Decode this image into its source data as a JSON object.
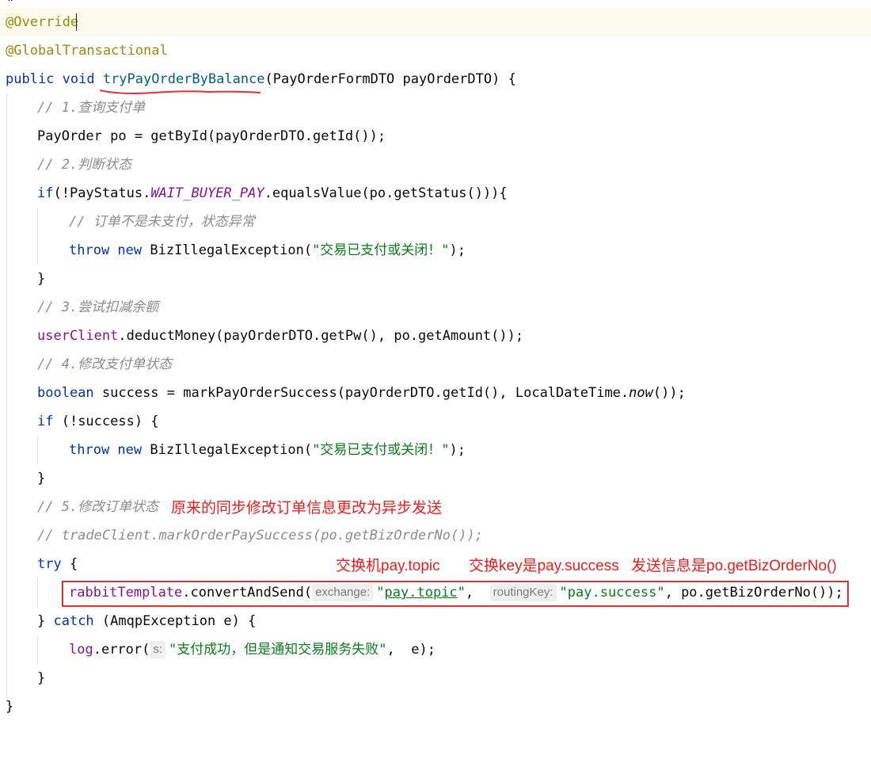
{
  "code_lines": {
    "l1": "@Override",
    "l2": "@GlobalTransactional",
    "l3": {
      "kw": "public void ",
      "method": "tryPayOrderByBalance",
      "rest": "(PayOrderFormDTO payOrderDTO) {"
    },
    "l4": "// 1.查询支付单",
    "l5": "PayOrder po = getById(payOrderDTO.getId());",
    "l6": "// 2.判断状态",
    "l7": {
      "a": "if",
      "b": "(!PayStatus.",
      "c": "WAIT_BUYER_PAY",
      "d": ".equalsValue(po.getStatus())){"
    },
    "l8": "// 订单不是未支付，状态异常",
    "l9": {
      "kw": "throw new ",
      "rest": "BizIllegalException(",
      "str": "\"交易已支付或关闭！\"",
      "end": ");"
    },
    "l10": "}",
    "l11": "// 3.尝试扣减余额",
    "l12": {
      "field": "userClient",
      "rest": ".deductMoney(payOrderDTO.getPw(), po.getAmount());"
    },
    "l13": "// 4.修改支付单状态",
    "l14": {
      "kw": "boolean ",
      "a": "success = markPayOrderSuccess(payOrderDTO.getId(), LocalDateTime.",
      "b": "now",
      "c": "());"
    },
    "l15": {
      "kw": "if ",
      "rest": "(!success) {"
    },
    "l16": {
      "kw": "throw new ",
      "rest": "BizIllegalException(",
      "str": "\"交易已支付或关闭！\"",
      "end": ");"
    },
    "l17": "}",
    "l18": "// 5.修改订单状态",
    "l19": "// tradeClient.markOrderPaySuccess(po.getBizOrderNo());",
    "l20": {
      "kw": "try ",
      "rest": "{"
    },
    "l21": {
      "field": "rabbitTemplate",
      "a": ".convertAndSend(",
      "hint1": "exchange:",
      "q1": "\"",
      "s1": "pay.topic",
      "q1e": "\"",
      "comma1": ",  ",
      "hint2": "routingKey:",
      "s2": "\"pay.success\"",
      "b": ", po.getBizOrderNo());"
    },
    "l22": {
      "a": "} ",
      "kw": "catch ",
      "rest": "(AmqpException e) {"
    },
    "l23": {
      "field": "log",
      "a": ".error(",
      "hint": "s:",
      "str": "\"支付成功，但是通知交易服务失败\"",
      "b": ",  e);"
    },
    "l24": "}",
    "l25": "}"
  },
  "annotations": {
    "note_step5": "原来的同步修改订单信息更改为异步发送",
    "note_exchange": "交换机pay.topic",
    "note_routing": "交换key是pay.success",
    "note_message": "发送信息是po.getBizOrderNo()"
  },
  "colors": {
    "annotation": "#9e880d",
    "keyword": "#0033b3",
    "method_declaration": "#00627a",
    "comment": "#8c8c8c",
    "constant_field": "#871094",
    "string": "#067d17",
    "red_markup": "#ee1c1c",
    "current_line": "#fcfaed"
  }
}
